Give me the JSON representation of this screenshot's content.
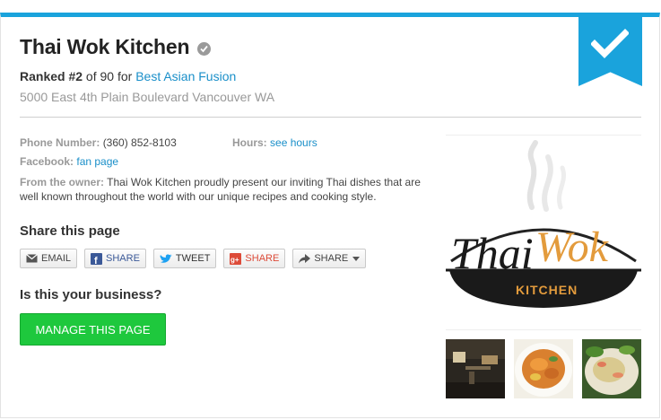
{
  "business": {
    "name": "Thai Wok Kitchen",
    "rank_label": "Ranked #2",
    "rank_mid": " of 90 for ",
    "rank_category": "Best Asian Fusion",
    "address": "5000 East 4th Plain Boulevard Vancouver WA"
  },
  "info": {
    "phone_label": "Phone Number:",
    "phone": "(360) 852-8103",
    "hours_label": "Hours:",
    "hours_link": "see hours",
    "facebook_label": "Facebook:",
    "facebook_link": "fan page",
    "owner_label": "From the owner:",
    "owner_text": "Thai Wok Kitchen proudly present our inviting Thai dishes that are well known throughout the world with our unique recipes and cooking style."
  },
  "share": {
    "title": "Share this page",
    "buttons": [
      "EMAIL",
      "SHARE",
      "TWEET",
      "SHARE",
      "SHARE"
    ]
  },
  "business_claim": {
    "title": "Is this your business?",
    "button": "MANAGE THIS PAGE"
  },
  "logo": {
    "word1": "Thai",
    "word2": "Wok",
    "word3": "KITCHEN"
  },
  "colors": {
    "accent": "#1aa3dc",
    "link": "#1a8fc9",
    "manage_button": "#1ec83d"
  }
}
